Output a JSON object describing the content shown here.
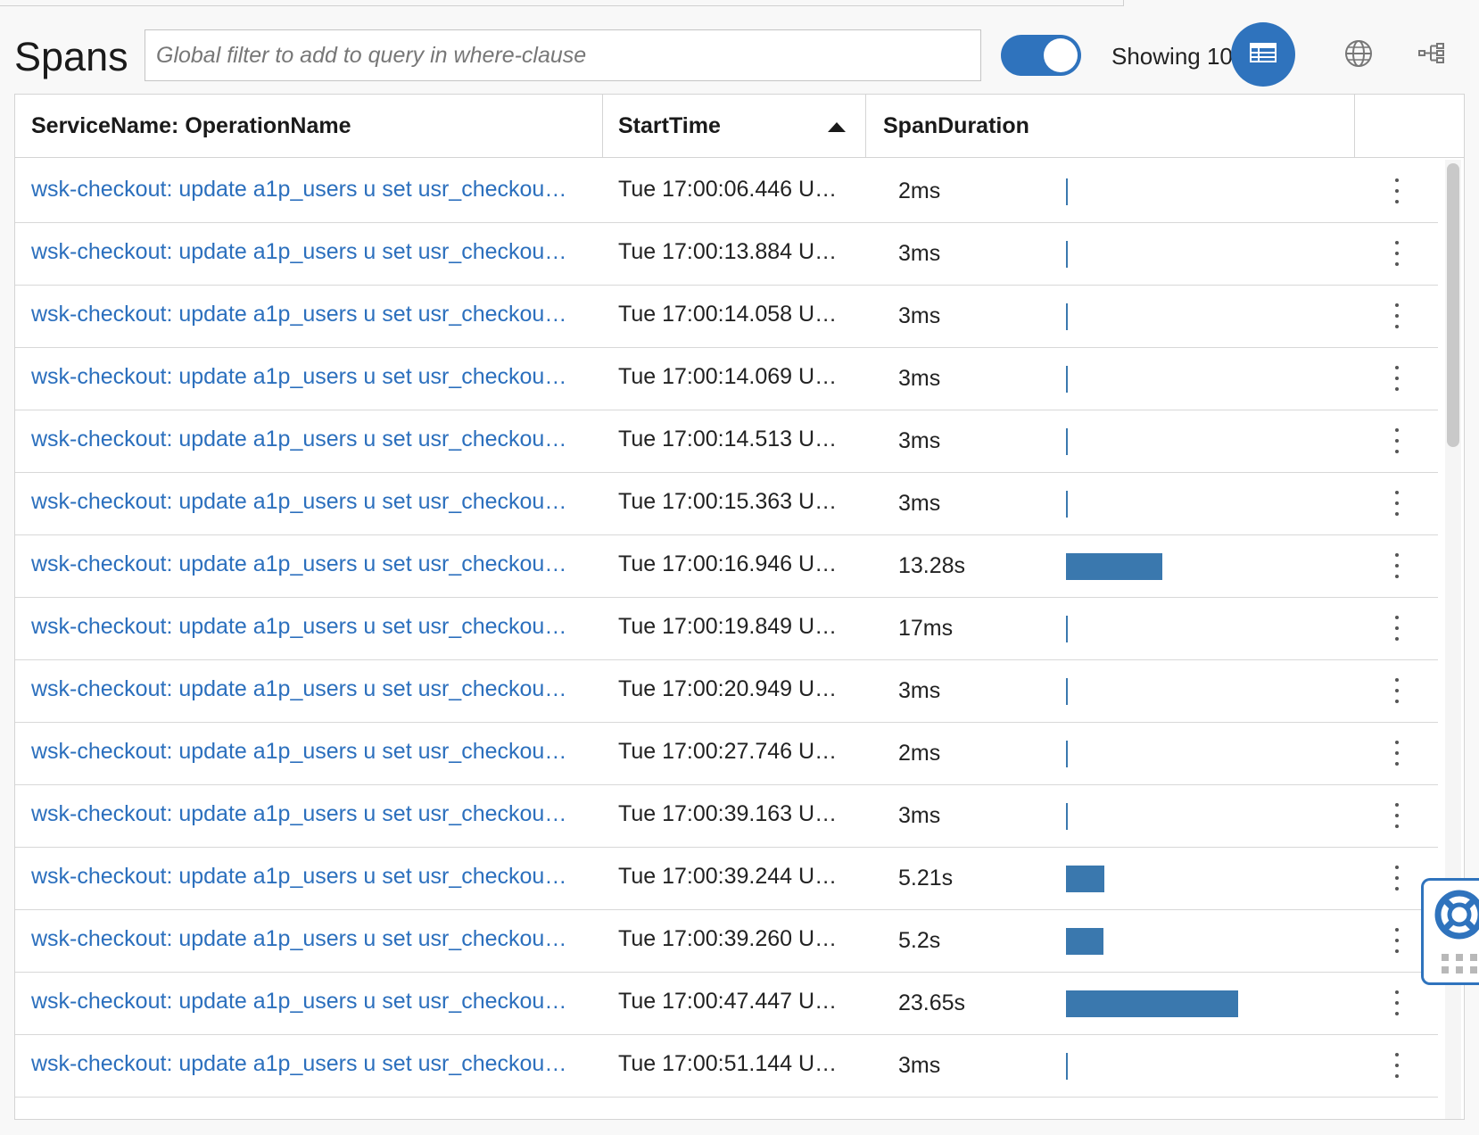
{
  "header": {
    "title": "Spans",
    "filter_placeholder": "Global filter to add to query in where-clause",
    "filter_value": "",
    "toggle_on": true,
    "showing_text": "Showing 100",
    "accent_color": "#2f73bd"
  },
  "icons": {
    "table_view": "table-icon",
    "map_view": "globe-icon",
    "tree_view": "tree-icon",
    "help": "lifebuoy-icon",
    "drag": "drag-handle-icon",
    "row_menu": "kebab-menu-icon"
  },
  "table": {
    "columns": [
      {
        "label": "ServiceName: OperationName"
      },
      {
        "label": "StartTime",
        "sort": "ascending"
      },
      {
        "label": "SpanDuration"
      }
    ],
    "duration_bar_color": "#3a78ae",
    "rows": [
      {
        "operation": "wsk-checkout: update a1p_users u set usr_checkou…",
        "start_time": "Tue 17:00:06.446 U…",
        "duration": "2ms",
        "duration_ms": 2
      },
      {
        "operation": "wsk-checkout: update a1p_users u set usr_checkou…",
        "start_time": "Tue 17:00:13.884 U…",
        "duration": "3ms",
        "duration_ms": 3
      },
      {
        "operation": "wsk-checkout: update a1p_users u set usr_checkou…",
        "start_time": "Tue 17:00:14.058 U…",
        "duration": "3ms",
        "duration_ms": 3
      },
      {
        "operation": "wsk-checkout: update a1p_users u set usr_checkou…",
        "start_time": "Tue 17:00:14.069 U…",
        "duration": "3ms",
        "duration_ms": 3
      },
      {
        "operation": "wsk-checkout: update a1p_users u set usr_checkou…",
        "start_time": "Tue 17:00:14.513 U…",
        "duration": "3ms",
        "duration_ms": 3
      },
      {
        "operation": "wsk-checkout: update a1p_users u set usr_checkou…",
        "start_time": "Tue 17:00:15.363 U…",
        "duration": "3ms",
        "duration_ms": 3
      },
      {
        "operation": "wsk-checkout: update a1p_users u set usr_checkou…",
        "start_time": "Tue 17:00:16.946 U…",
        "duration": "13.28s",
        "duration_ms": 13280
      },
      {
        "operation": "wsk-checkout: update a1p_users u set usr_checkou…",
        "start_time": "Tue 17:00:19.849 U…",
        "duration": "17ms",
        "duration_ms": 17
      },
      {
        "operation": "wsk-checkout: update a1p_users u set usr_checkou…",
        "start_time": "Tue 17:00:20.949 U…",
        "duration": "3ms",
        "duration_ms": 3
      },
      {
        "operation": "wsk-checkout: update a1p_users u set usr_checkou…",
        "start_time": "Tue 17:00:27.746 U…",
        "duration": "2ms",
        "duration_ms": 2
      },
      {
        "operation": "wsk-checkout: update a1p_users u set usr_checkou…",
        "start_time": "Tue 17:00:39.163 U…",
        "duration": "3ms",
        "duration_ms": 3
      },
      {
        "operation": "wsk-checkout: update a1p_users u set usr_checkou…",
        "start_time": "Tue 17:00:39.244 U…",
        "duration": "5.21s",
        "duration_ms": 5210
      },
      {
        "operation": "wsk-checkout: update a1p_users u set usr_checkou…",
        "start_time": "Tue 17:00:39.260 U…",
        "duration": "5.2s",
        "duration_ms": 5200
      },
      {
        "operation": "wsk-checkout: update a1p_users u set usr_checkou…",
        "start_time": "Tue 17:00:47.447 U…",
        "duration": "23.65s",
        "duration_ms": 23650
      },
      {
        "operation": "wsk-checkout: update a1p_users u set usr_checkou…",
        "start_time": "Tue 17:00:51.144 U…",
        "duration": "3ms",
        "duration_ms": 3
      }
    ]
  }
}
